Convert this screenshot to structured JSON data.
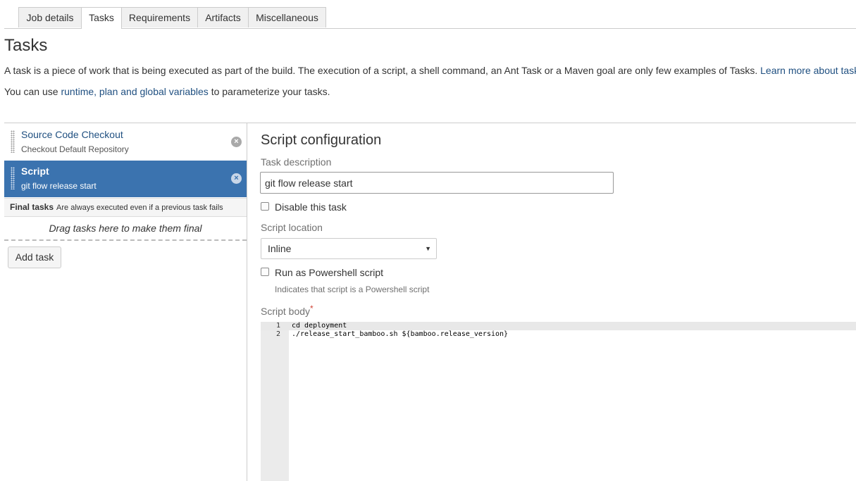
{
  "tabs": [
    {
      "label": "Job details"
    },
    {
      "label": "Tasks"
    },
    {
      "label": "Requirements"
    },
    {
      "label": "Artifacts"
    },
    {
      "label": "Miscellaneous"
    }
  ],
  "active_tab": "Tasks",
  "page": {
    "title": "Tasks",
    "intro_text": "A task is a piece of work that is being executed as part of the build. The execution of a script, a shell command, an Ant Task or a Maven goal are only few examples of Tasks. ",
    "intro_link": "Learn more about tasks",
    "vars_prefix": "You can use ",
    "vars_link": "runtime, plan and global variables",
    "vars_suffix": " to parameterize your tasks."
  },
  "tasks": [
    {
      "title": "Source Code Checkout",
      "subtitle": "Checkout Default Repository",
      "remove_icon": "×"
    },
    {
      "title": "Script",
      "subtitle": "git flow release start",
      "remove_icon": "×"
    }
  ],
  "final_tasks": {
    "label": "Final tasks",
    "description": "Are always executed even if a previous task fails",
    "drop_hint": "Drag tasks here to make them final"
  },
  "add_task_label": "Add task",
  "config": {
    "title": "Script configuration",
    "task_description_label": "Task description",
    "task_description_value": "git flow release start",
    "disable_label": "Disable this task",
    "script_location_label": "Script location",
    "script_location_value": "Inline",
    "powershell_label": "Run as Powershell script",
    "powershell_hint": "Indicates that script is a Powershell script",
    "script_body_label": "Script body",
    "required_marker": "*"
  },
  "script_body": [
    {
      "line": "1",
      "code": "cd deployment"
    },
    {
      "line": "2",
      "code": "./release_start_bamboo.sh ${bamboo.release_version}"
    }
  ],
  "colors": {
    "accent": "#3b73af",
    "link": "#205081"
  }
}
